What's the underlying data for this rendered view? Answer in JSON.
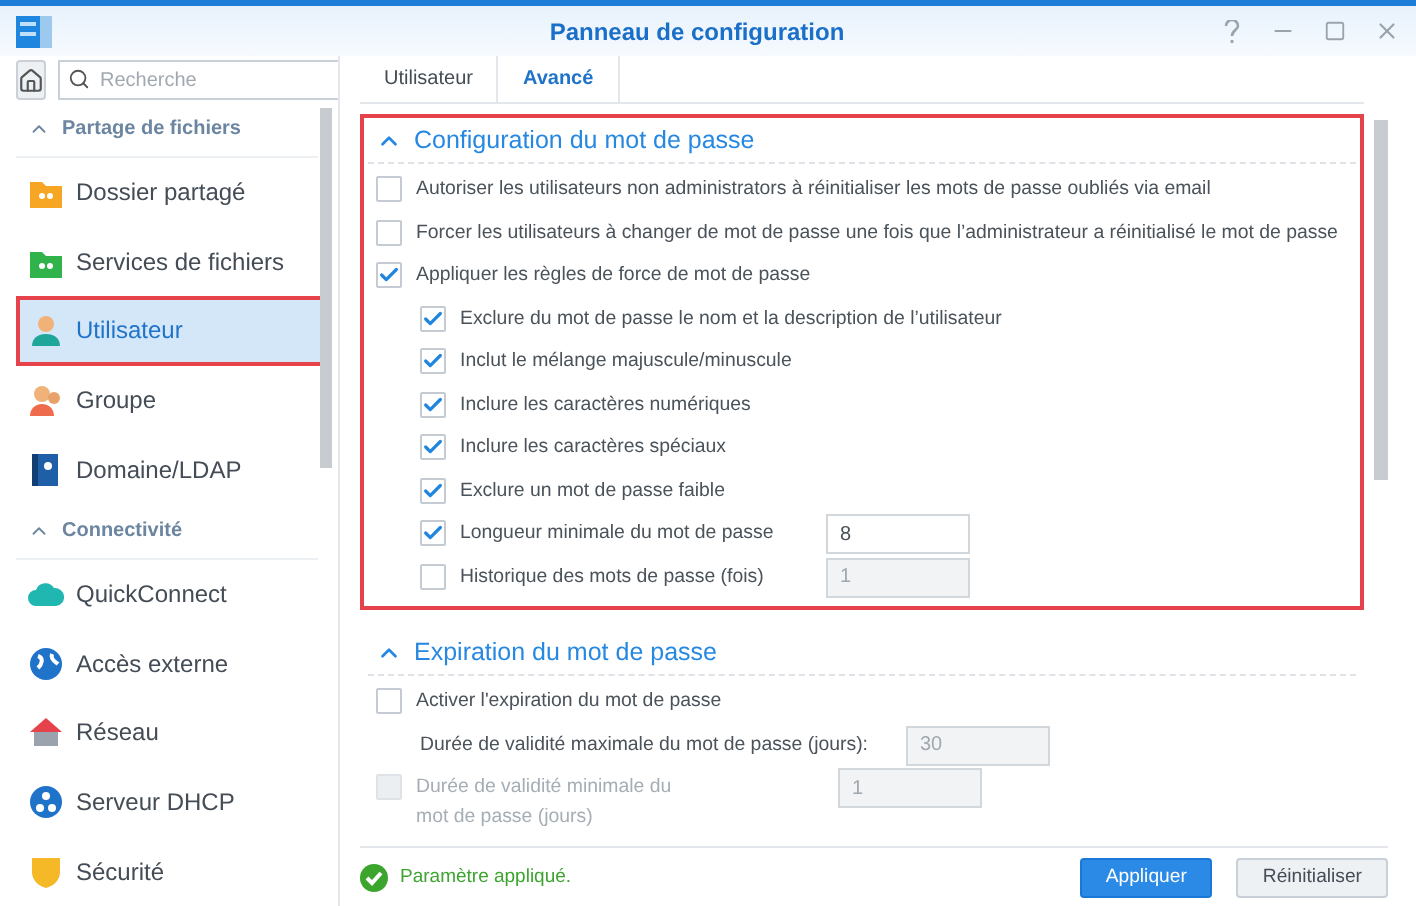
{
  "window": {
    "title": "Panneau de configuration"
  },
  "sidebar": {
    "search": {
      "placeholder": "Recherche"
    },
    "groups": [
      {
        "title": "Partage de fichiers",
        "expanded": true,
        "items": [
          {
            "label": "Dossier partagé",
            "kind": "folder",
            "selected": false,
            "highlighted": false
          },
          {
            "label": "Services de fichiers",
            "kind": "services",
            "selected": false,
            "highlighted": false
          },
          {
            "label": "Utilisateur",
            "kind": "user",
            "selected": true,
            "highlighted": true
          },
          {
            "label": "Groupe",
            "kind": "group",
            "selected": false,
            "highlighted": false
          },
          {
            "label": "Domaine/LDAP",
            "kind": "directory",
            "selected": false,
            "highlighted": false
          }
        ]
      },
      {
        "title": "Connectivité",
        "expanded": true,
        "items": [
          {
            "label": "QuickConnect",
            "kind": "cloud",
            "selected": false,
            "highlighted": false
          },
          {
            "label": "Accès externe",
            "kind": "globe",
            "selected": false,
            "highlighted": false
          },
          {
            "label": "Réseau",
            "kind": "house",
            "selected": false,
            "highlighted": false
          },
          {
            "label": "Serveur DHCP",
            "kind": "dhcp",
            "selected": false,
            "highlighted": false
          },
          {
            "label": "Sécurité",
            "kind": "shield",
            "selected": false,
            "highlighted": false
          }
        ]
      }
    ]
  },
  "tabs": [
    {
      "label": "Utilisateur",
      "selected": false
    },
    {
      "label": "Avancé",
      "selected": true
    }
  ],
  "sections": [
    {
      "title": "Configuration du mot de passe",
      "expanded": true,
      "highlighted": true,
      "options": [
        {
          "kind": "checkbox",
          "label": "Autoriser les utilisateurs non administrators à réinitialiser les mots de passe oubliés via email",
          "checked": false,
          "disabled": false
        },
        {
          "kind": "checkbox",
          "label": "Forcer les utilisateurs à changer de mot de passe une fois que l’administrateur a réinitialisé le mot de passe",
          "checked": false,
          "disabled": false
        },
        {
          "kind": "checkbox",
          "label": "Appliquer les règles de force de mot de passe",
          "checked": true,
          "disabled": false,
          "children": [
            {
              "kind": "checkbox",
              "label": "Exclure du mot de passe le nom et la description de l’utilisateur",
              "checked": true,
              "disabled": false
            },
            {
              "kind": "checkbox",
              "label": "Inclut le mélange majuscule/minuscule",
              "checked": true,
              "disabled": false
            },
            {
              "kind": "checkbox",
              "label": "Inclure les caractères numériques",
              "checked": true,
              "disabled": false
            },
            {
              "kind": "checkbox",
              "label": "Inclure les caractères spéciaux",
              "checked": true,
              "disabled": false
            },
            {
              "kind": "checkbox",
              "label": "Exclure un mot de passe faible",
              "checked": true,
              "disabled": false
            },
            {
              "kind": "checkbox",
              "label": "Longueur minimale du mot de passe",
              "checked": true,
              "disabled": false,
              "field": {
                "value": "8",
                "disabled": false
              }
            },
            {
              "kind": "checkbox",
              "label": "Historique des mots de passe (fois)",
              "checked": false,
              "disabled": false,
              "field": {
                "value": "1",
                "disabled": true
              }
            }
          ]
        }
      ]
    },
    {
      "title": "Expiration du mot de passe",
      "expanded": true,
      "highlighted": false,
      "options": [
        {
          "kind": "checkbox",
          "label": "Activer l'expiration du mot de passe",
          "checked": false,
          "disabled": false
        },
        {
          "kind": "field",
          "label": "Durée de validité maximale du mot de passe (jours):",
          "field": {
            "value": "30",
            "disabled": true
          }
        },
        {
          "kind": "checkbox",
          "label": "Durée de validité minimale du mot de passe (jours)",
          "checked": false,
          "disabled": true,
          "field": {
            "value": "1",
            "disabled": true
          }
        }
      ]
    }
  ],
  "status": {
    "text": "Paramètre appliqué."
  },
  "buttons": [
    {
      "label": "Appliquer",
      "kind": "primary"
    },
    {
      "label": "Réinitialiser",
      "kind": "secondary"
    }
  ]
}
